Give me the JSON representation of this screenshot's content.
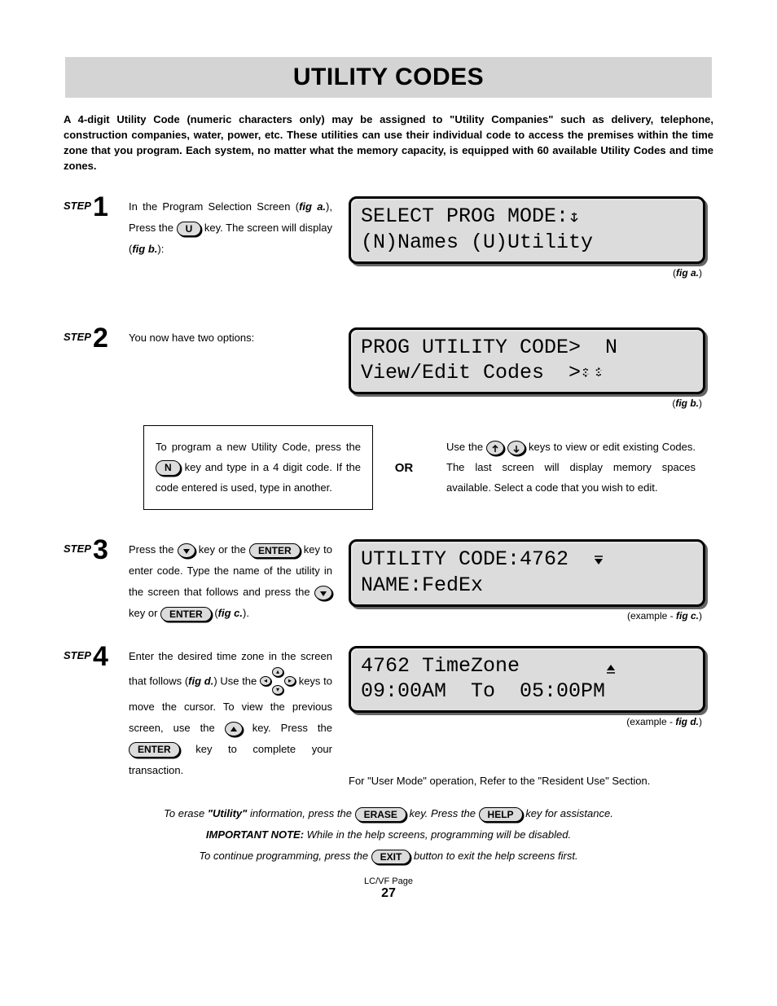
{
  "title": "UTILITY CODES",
  "intro": "A 4-digit Utility Code (numeric characters only) may be assigned to \"Utility Companies\" such as delivery, telephone, construction companies, water, power, etc. These utilities can use their individual code to access the premises within the time zone that you program. Each system, no matter what the memory capacity, is equipped with 60 available Utility Codes and time zones.",
  "step_label": "STEP",
  "steps": {
    "s1": {
      "num": "1",
      "t1": "In the Program Selection Screen (",
      "fig": "fig a.",
      "t2": "), Press the ",
      "key": "U",
      "t3": " key.  The screen will display (",
      "fig2": "fig b.",
      "t4": "):"
    },
    "s2": {
      "num": "2",
      "text": "You now have two options:"
    },
    "s3": {
      "num": "3",
      "t1": "Press the ",
      "t2": " key or the ",
      "k_enter": "ENTER",
      "t3": " key to enter code. Type the name of the utility in the screen that follows and press the ",
      "t4": " key or ",
      "t5": " (",
      "fig": "fig c.",
      "t6": ")."
    },
    "s4": {
      "num": "4",
      "t1": "Enter the desired time zone in the screen that follows (",
      "fig": "fig d.",
      "t2": ") Use the ",
      "t3": " keys to move the cursor. To view the previous screen, use the ",
      "t4": " key.  Press the ",
      "k_enter": "ENTER",
      "t5": " key to complete your transaction."
    }
  },
  "opt": {
    "left": {
      "t1": "To program a new Utility Code, press the ",
      "key": "N",
      "t2": " key and type in a 4 digit code. If the code entered is used, type in another."
    },
    "or": "OR",
    "right": {
      "t1": "Use the ",
      "t2": " keys to view or edit existing Codes. The last screen will display memory spaces available. Select a code that you wish to edit."
    }
  },
  "lcd": {
    "a1": "SELECT PROG MODE:",
    "a2": "(N)Names (U)Utility",
    "b1": "PROG UTILITY CODE>  N",
    "b2": "View/Edit Codes  >",
    "c1": "UTILITY CODE:4762",
    "c2": "NAME:FedEx",
    "d1": "4762 TimeZone",
    "d2": "09:00AM  To  05:00PM"
  },
  "figs": {
    "a": "fig a.",
    "b": "fig b.",
    "c": "fig c.",
    "d": "fig d.",
    "ex": "(example - ",
    "close": ")",
    "open": "("
  },
  "ref_note": "For \"User Mode\" operation, Refer to the \"Resident Use\" Section.",
  "footer": {
    "l1a": "To erase ",
    "l1b": "\"Utility\"",
    "l1c": " information, press the ",
    "k_erase": "ERASE",
    "l1d": " key. Press the ",
    "k_help": "HELP",
    "l1e": " key for assistance.",
    "l2a": "IMPORTANT NOTE:",
    "l2b": " While in the help screens, programming will be disabled.",
    "l3a": "To continue programming, press the ",
    "k_exit": "EXIT",
    "l3b": " button to exit the help screens first."
  },
  "page": {
    "label": "LC/VF Page",
    "num": "27"
  }
}
